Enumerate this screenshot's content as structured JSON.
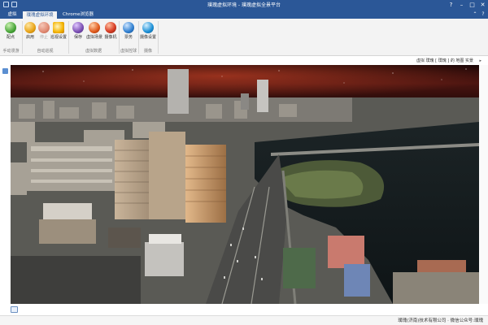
{
  "window": {
    "title": "璞瑰虚拟环境 - 璞瑰虚拟全景平台",
    "controls": {
      "help": "?",
      "minimize": "–",
      "maximize": "□",
      "close": "✕"
    }
  },
  "tabs": [
    {
      "label": "虚拟"
    },
    {
      "label": "璞瑰虚拟环境"
    },
    {
      "label": "Chrome浏览器"
    }
  ],
  "ribbon": {
    "buttons": [
      {
        "label": "配点",
        "color": "#4aa63a"
      },
      {
        "label": "启用",
        "color": "#e8a317"
      },
      {
        "label": "停止",
        "color": "#d9d9d9"
      },
      {
        "label": "巡视设置",
        "color": "#f4b400"
      },
      {
        "label": "保存",
        "color": "#7b4fb3"
      },
      {
        "label": "虚拟场景",
        "color": "#e05a1c"
      },
      {
        "label": "摄像机",
        "color": "#d93f27"
      },
      {
        "label": "票务",
        "color": "#2f7fd0"
      },
      {
        "label": "摄像设置",
        "color": "#1b8fd6"
      }
    ],
    "groups": [
      {
        "label": "手动漫游"
      },
      {
        "label": "自动巡视"
      },
      {
        "label": "虚拟数据"
      },
      {
        "label": "虚拟控球"
      },
      {
        "label": "摄像"
      }
    ]
  },
  "address": {
    "path": "虚拟 璞瑰 [ 璞瑰 ] 的 地图 实景"
  },
  "statusbar": {
    "text": "璞瑰(济南)技术有限公司 · 微信公众号:璞瑰"
  },
  "icons": {
    "app": "app-icon",
    "help": "help-icon",
    "scene_tool": "scene-tool-icon",
    "status": "status-icon"
  }
}
